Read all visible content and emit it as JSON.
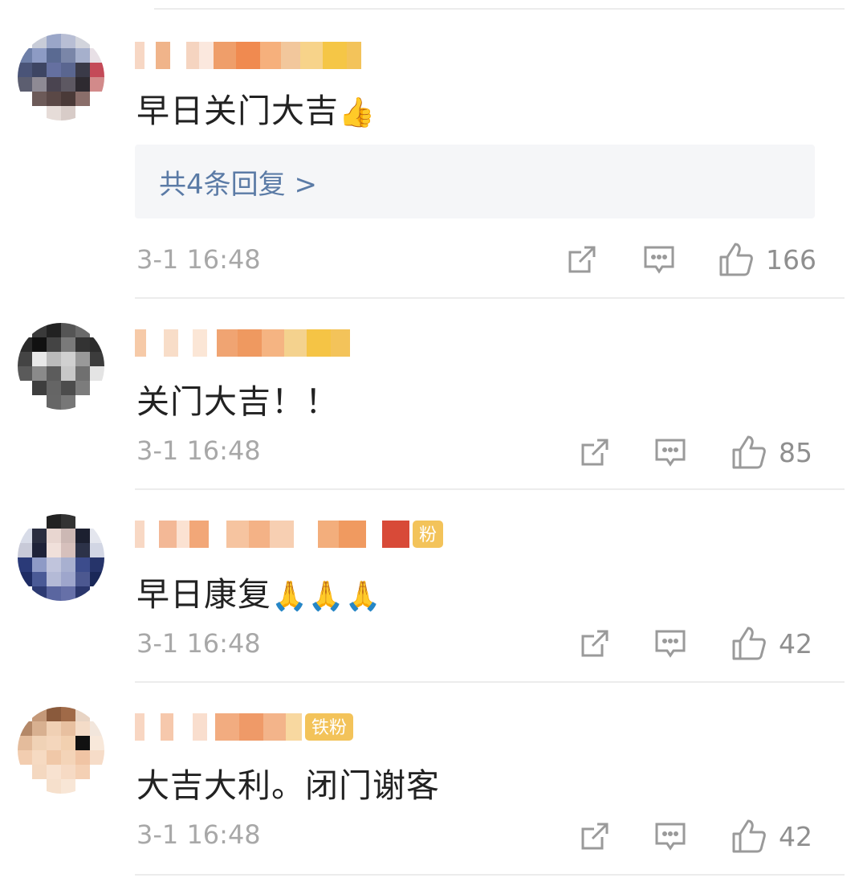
{
  "comments": [
    {
      "text": "早日关门大吉",
      "emoji": "👍",
      "replies_label": "共4条回复 >",
      "time": "3-1 16:48",
      "likes": "166"
    },
    {
      "text": "关门大吉！！",
      "emoji": "",
      "time": "3-1 16:48",
      "likes": "85"
    },
    {
      "text": "早日康复",
      "emoji": "🙏🙏🙏",
      "badge": "粉",
      "time": "3-1 16:48",
      "likes": "42"
    },
    {
      "text": "大吉大利。闭门谢客",
      "emoji": "",
      "badge": "铁粉",
      "time": "3-1 16:48",
      "likes": "42"
    }
  ],
  "icons": {
    "share": "share-icon",
    "comment": "comment-icon",
    "like": "thumbs-up-icon"
  },
  "colors": {
    "reply_link": "#5b7ba6",
    "meta_gray": "#a8a8a8",
    "badge": "#f3c35a"
  }
}
